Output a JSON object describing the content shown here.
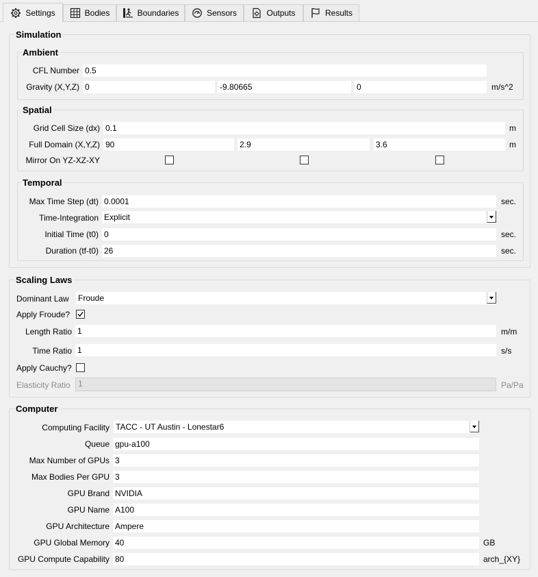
{
  "tabs": [
    {
      "label": "Settings",
      "icon": "gear-icon"
    },
    {
      "label": "Bodies",
      "icon": "grid-icon"
    },
    {
      "label": "Boundaries",
      "icon": "boundaries-icon"
    },
    {
      "label": "Sensors",
      "icon": "sensor-icon"
    },
    {
      "label": "Outputs",
      "icon": "outputs-icon"
    },
    {
      "label": "Results",
      "icon": "flag-icon"
    }
  ],
  "simulation": {
    "title": "Simulation",
    "ambient": {
      "title": "Ambient",
      "cfl_label": "CFL Number",
      "cfl_value": "0.5",
      "gravity_label": "Gravity (X,Y,Z)",
      "gravity_x": "0",
      "gravity_y": "-9.80665",
      "gravity_z": "0",
      "gravity_unit": "m/s^2"
    },
    "spatial": {
      "title": "Spatial",
      "dx_label": "Grid Cell Size (dx)",
      "dx_value": "0.1",
      "dx_unit": "m",
      "domain_label": "Full Domain (X,Y,Z)",
      "domain_x": "90",
      "domain_y": "2.9",
      "domain_z": "3.6",
      "domain_unit": "m",
      "mirror_label": "Mirror On YZ-XZ-XY",
      "mirror_yz": false,
      "mirror_xz": false,
      "mirror_xy": false
    },
    "temporal": {
      "title": "Temporal",
      "dt_label": "Max Time Step (dt)",
      "dt_value": "0.0001",
      "dt_unit": "sec.",
      "integration_label": "Time-Integration",
      "integration_value": "Explicit",
      "t0_label": "Initial Time (t0)",
      "t0_value": "0",
      "t0_unit": "sec.",
      "duration_label": "Duration (tf-t0)",
      "duration_value": "26",
      "duration_unit": "sec."
    }
  },
  "scaling": {
    "title": "Scaling Laws",
    "dominant_label": "Dominant Law",
    "dominant_value": "Froude",
    "froude_label": "Apply Froude?",
    "froude_checked": true,
    "length_label": "Length Ratio",
    "length_value": "1",
    "length_unit": "m/m",
    "time_label": "Time Ratio",
    "time_value": "1",
    "time_unit": "s/s",
    "cauchy_label": "Apply Cauchy?",
    "cauchy_checked": false,
    "elasticity_label": "Elasticity Ratio",
    "elasticity_value": "1",
    "elasticity_unit": "Pa/Pa"
  },
  "computer": {
    "title": "Computer",
    "facility_label": "Computing Facility",
    "facility_value": "TACC - UT Austin - Lonestar6",
    "queue_label": "Queue",
    "queue_value": "gpu-a100",
    "gpus_label": "Max Number of GPUs",
    "gpus_value": "3",
    "bodies_label": "Max Bodies Per GPU",
    "bodies_value": "3",
    "brand_label": "GPU Brand",
    "brand_value": "NVIDIA",
    "name_label": "GPU Name",
    "name_value": "A100",
    "arch_label": "GPU Architecture",
    "arch_value": "Ampere",
    "memory_label": "GPU Global Memory",
    "memory_value": "40",
    "memory_unit": "GB",
    "cc_label": "GPU Compute Capability",
    "cc_value": "80",
    "cc_unit": "arch_{XY}"
  }
}
